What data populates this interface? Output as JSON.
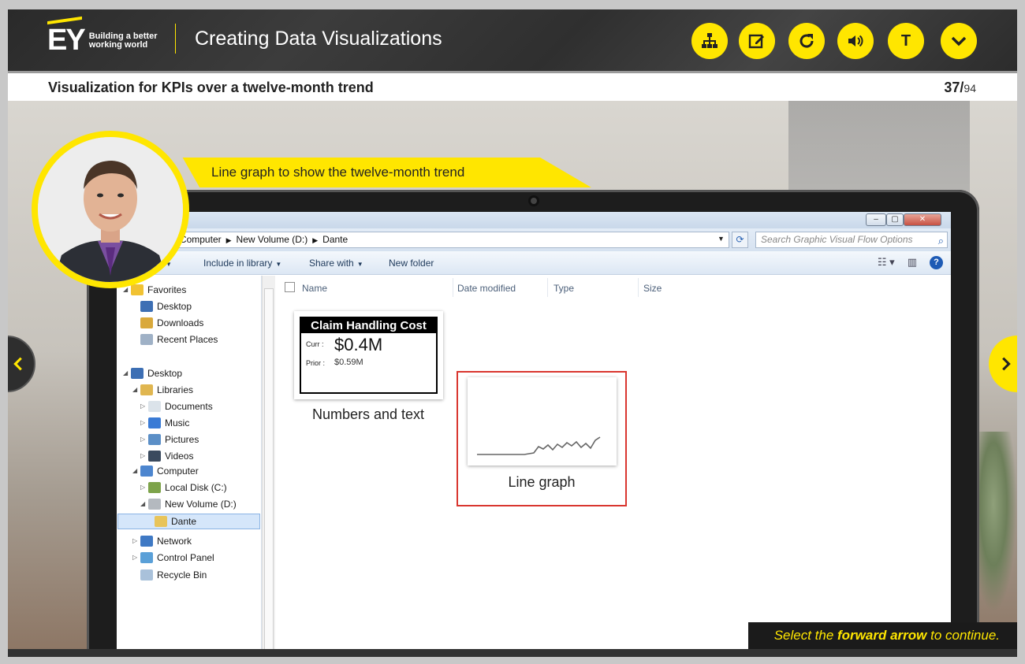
{
  "header": {
    "logo_text": "EY",
    "logo_tagline": "Building a better working world",
    "course_title": "Creating Data Visualizations",
    "tools": [
      {
        "name": "sitemap",
        "label": ""
      },
      {
        "name": "notes",
        "label": ""
      },
      {
        "name": "replay",
        "label": ""
      },
      {
        "name": "audio",
        "label": ""
      },
      {
        "name": "transcript",
        "label": "T"
      },
      {
        "name": "menu",
        "label": ""
      }
    ],
    "accent_color": "#ffe600"
  },
  "slide": {
    "title": "Visualization for KPIs over a twelve-month trend",
    "page_current": "37/",
    "page_total": "94"
  },
  "callout": {
    "text": "Line graph to show the twelve-month trend"
  },
  "explorer": {
    "breadcrumb": [
      "Computer",
      "New Volume (D:)",
      "Dante"
    ],
    "search_placeholder": "Search Graphic Visual Flow Options",
    "toolbar": {
      "organize": "nize",
      "include": "Include in library",
      "share": "Share with",
      "new_folder": "New folder"
    },
    "nav": {
      "favorites": "Favorites",
      "desktop_fav": "Desktop",
      "downloads": "Downloads",
      "recent": "Recent Places",
      "desktop": "Desktop",
      "libraries": "Libraries",
      "documents": "Documents",
      "music": "Music",
      "pictures": "Pictures",
      "videos": "Videos",
      "computer": "Computer",
      "local_disk": "Local Disk (C:)",
      "new_volume": "New Volume (D:)",
      "dante": "Dante",
      "network": "Network",
      "control_panel": "Control Panel",
      "recycle_bin": "Recycle Bin"
    },
    "columns": {
      "name": "Name",
      "date": "Date modified",
      "type": "Type",
      "size": "Size"
    },
    "files": [
      {
        "label": "Numbers and text",
        "kpi_title": "Claim Handling Cost",
        "curr_label": "Curr :",
        "curr_value": "$0.4M",
        "prior_label": "Prior :",
        "prior_value": "$0.59M"
      },
      {
        "label": "Line graph",
        "selected": true
      }
    ]
  },
  "instruction": {
    "before": "Select the ",
    "bold": "forward arrow",
    "after": " to continue."
  }
}
